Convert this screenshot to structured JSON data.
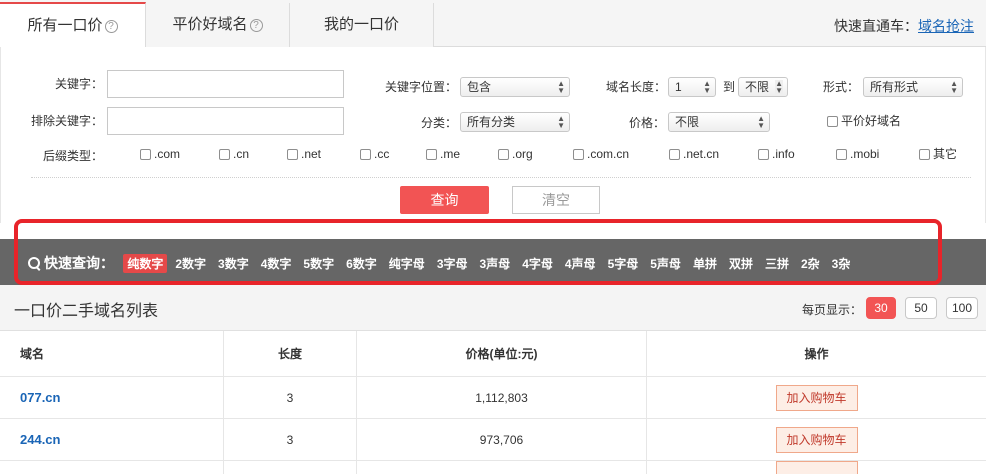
{
  "tabs": [
    {
      "label": "所有一口价",
      "help": "?"
    },
    {
      "label": "平价好域名",
      "help": "?"
    },
    {
      "label": "我的一口价"
    }
  ],
  "quick_nav": {
    "label": "快速直通车：",
    "link": "域名抢注"
  },
  "form": {
    "keyword_label": "关键字：",
    "exclude_label": "排除关键字：",
    "keyword_pos_label": "关键字位置：",
    "keyword_pos_value": "包含",
    "length_label": "域名长度：",
    "length_from": "1",
    "length_to_label": "到",
    "length_to": "不限",
    "form_label": "形式：",
    "form_value": "所有形式",
    "category_label": "分类：",
    "category_value": "所有分类",
    "price_label": "价格：",
    "price_value": "不限",
    "cheap_label": "平价好域名",
    "suffix_label": "后缀类型：",
    "suffixes": [
      ".com",
      ".cn",
      ".net",
      ".cc",
      ".me",
      ".org",
      ".com.cn",
      ".net.cn",
      ".info",
      ".mobi",
      "其它"
    ],
    "query_btn": "查询",
    "clear_btn": "清空"
  },
  "quickbar": {
    "label": "快速查询：",
    "items": [
      "纯数字",
      "2数字",
      "3数字",
      "4数字",
      "5数字",
      "6数字",
      "纯字母",
      "3字母",
      "3声母",
      "4字母",
      "4声母",
      "5字母",
      "5声母",
      "单拼",
      "双拼",
      "三拼",
      "2杂",
      "3杂"
    ],
    "active_index": 0
  },
  "list": {
    "title": "一口价二手域名列表",
    "per_page_label": "每页显示：",
    "per_page_options": [
      "30",
      "50",
      "100"
    ],
    "per_page_active": 0,
    "columns": [
      "域名",
      "长度",
      "价格(单位:元)",
      "操作"
    ],
    "rows": [
      {
        "domain": "077.cn",
        "length": "3",
        "price": "1,112,803",
        "action": "加入购物车"
      },
      {
        "domain": "244.cn",
        "length": "3",
        "price": "973,706",
        "action": "加入购物车"
      }
    ]
  },
  "colors": {
    "accent": "#f25454",
    "link": "#1a65b6",
    "quickbar_bg": "#666666"
  }
}
